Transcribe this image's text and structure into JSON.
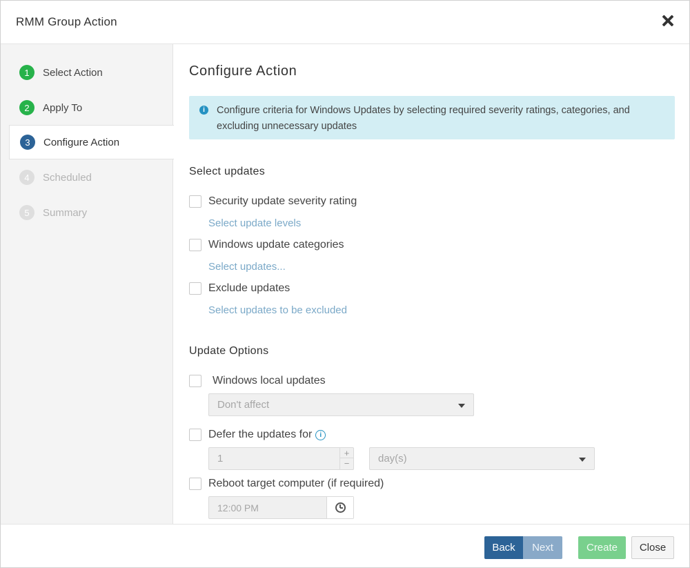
{
  "window": {
    "title": "RMM Group Action"
  },
  "steps": [
    {
      "num": "1",
      "label": "Select Action"
    },
    {
      "num": "2",
      "label": "Apply To"
    },
    {
      "num": "3",
      "label": "Configure Action"
    },
    {
      "num": "4",
      "label": "Scheduled"
    },
    {
      "num": "5",
      "label": "Summary"
    }
  ],
  "main": {
    "title": "Configure Action",
    "info_text": "Configure criteria for Windows Updates by selecting required severity ratings, categories, and excluding unnecessary updates",
    "select_updates": {
      "title": "Select updates",
      "security_label": "Security update severity rating",
      "security_link": "Select update levels",
      "categories_label": "Windows update categories",
      "categories_link": "Select updates...",
      "exclude_label": "Exclude updates",
      "exclude_link": "Select updates to be excluded"
    },
    "update_options": {
      "title": "Update Options",
      "local_label": "Windows local updates",
      "local_value": "Don't affect",
      "defer_label": "Defer the updates for",
      "defer_value": "1",
      "defer_unit": "day(s)",
      "reboot_label": "Reboot target computer (if required)",
      "reboot_time": "12:00 PM"
    }
  },
  "footer": {
    "back": "Back",
    "next": "Next",
    "create": "Create",
    "close": "Close"
  },
  "colors": {
    "accent": "#2c6397",
    "done": "#27b24a",
    "info_bg": "#d3eef4",
    "link": "#7ba9c8",
    "create": "#79d08d"
  }
}
